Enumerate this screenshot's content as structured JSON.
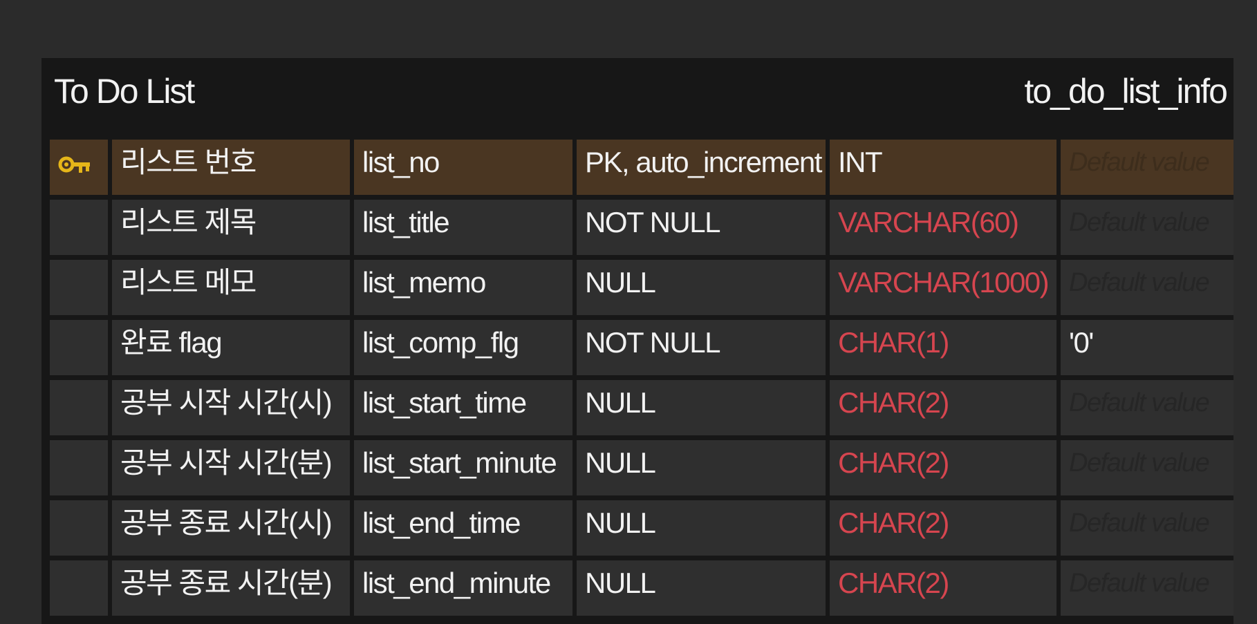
{
  "entity": {
    "logical_name": "To Do List",
    "physical_name": "to_do_list_info"
  },
  "colors": {
    "canvas_bg": "#2b2b2b",
    "entity_bg": "#171717",
    "cell_bg": "#2f2f2f",
    "pk_row_bg": "#4a3622",
    "key_icon": "#e6b619",
    "text": "#f2f2f2",
    "type_highlight": "#d6454f"
  },
  "columns": [
    {
      "logical": "리스트 번호",
      "physical": "list_no",
      "option": "PK, auto_increment",
      "type": "INT",
      "default": "Default value",
      "is_pk": true,
      "type_highlight": false,
      "default_is_placeholder": true,
      "icon": "key-icon"
    },
    {
      "logical": "리스트 제목",
      "physical": "list_title",
      "option": "NOT NULL",
      "type": "VARCHAR(60)",
      "default": "Default value",
      "is_pk": false,
      "type_highlight": true,
      "default_is_placeholder": true
    },
    {
      "logical": "리스트 메모",
      "physical": "list_memo",
      "option": "NULL",
      "type": "VARCHAR(1000)",
      "default": "Default value",
      "is_pk": false,
      "type_highlight": true,
      "default_is_placeholder": true
    },
    {
      "logical": "완료 flag",
      "physical": "list_comp_flg",
      "option": "NOT NULL",
      "type": "CHAR(1)",
      "default": "'0'",
      "is_pk": false,
      "type_highlight": true,
      "default_is_placeholder": false
    },
    {
      "logical": "공부 시작 시간(시)",
      "physical": "list_start_time",
      "option": "NULL",
      "type": "CHAR(2)",
      "default": "Default value",
      "is_pk": false,
      "type_highlight": true,
      "default_is_placeholder": true
    },
    {
      "logical": "공부 시작 시간(분)",
      "physical": "list_start_minute",
      "option": "NULL",
      "type": "CHAR(2)",
      "default": "Default value",
      "is_pk": false,
      "type_highlight": true,
      "default_is_placeholder": true
    },
    {
      "logical": "공부 종료 시간(시)",
      "physical": "list_end_time",
      "option": "NULL",
      "type": "CHAR(2)",
      "default": "Default value",
      "is_pk": false,
      "type_highlight": true,
      "default_is_placeholder": true
    },
    {
      "logical": "공부 종료 시간(분)",
      "physical": "list_end_minute",
      "option": "NULL",
      "type": "CHAR(2)",
      "default": "Default value",
      "is_pk": false,
      "type_highlight": true,
      "default_is_placeholder": true
    }
  ]
}
